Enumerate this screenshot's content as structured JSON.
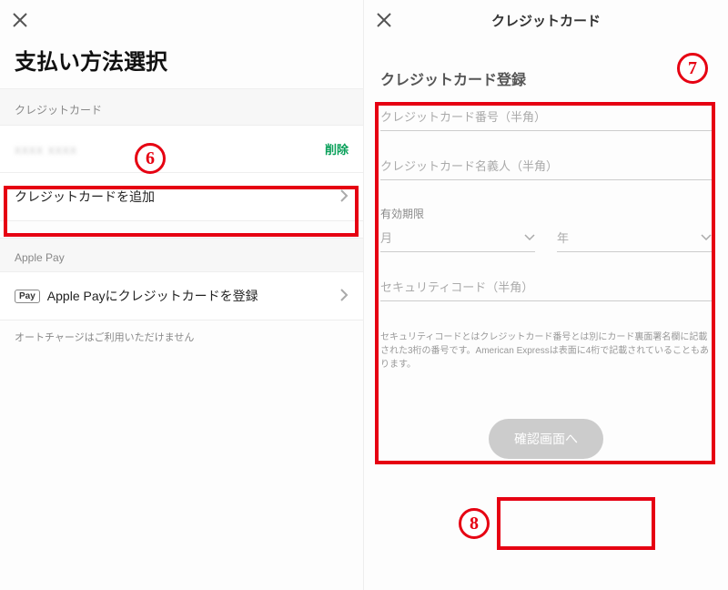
{
  "left": {
    "title": "支払い方法選択",
    "section_cc": "クレジットカード",
    "existing_blur": "xxxx xxxx",
    "delete_label": "削除",
    "add_card_label": "クレジットカードを追加",
    "section_apple": "Apple Pay",
    "applepay_badge": "Pay",
    "applepay_label": "Apple Payにクレジットカードを登録",
    "applepay_note": "オートチャージはご利用いただけません"
  },
  "right": {
    "header_title": "クレジットカード",
    "subheader": "クレジットカード登録",
    "ph_number": "クレジットカード番号（半角）",
    "ph_name": "クレジットカード名義人（半角）",
    "expiry_label": "有効期限",
    "ph_month": "月",
    "ph_year": "年",
    "ph_cvv": "セキュリティコード（半角）",
    "cvv_help": "セキュリティコードとはクレジットカード番号とは別にカード裏面署名欄に記載された3桁の番号です。American Expressは表面に4桁で記載されていることもあります。",
    "confirm_label": "確認画面へ"
  },
  "annotations": {
    "n6": "6",
    "n7": "7",
    "n8": "8"
  }
}
